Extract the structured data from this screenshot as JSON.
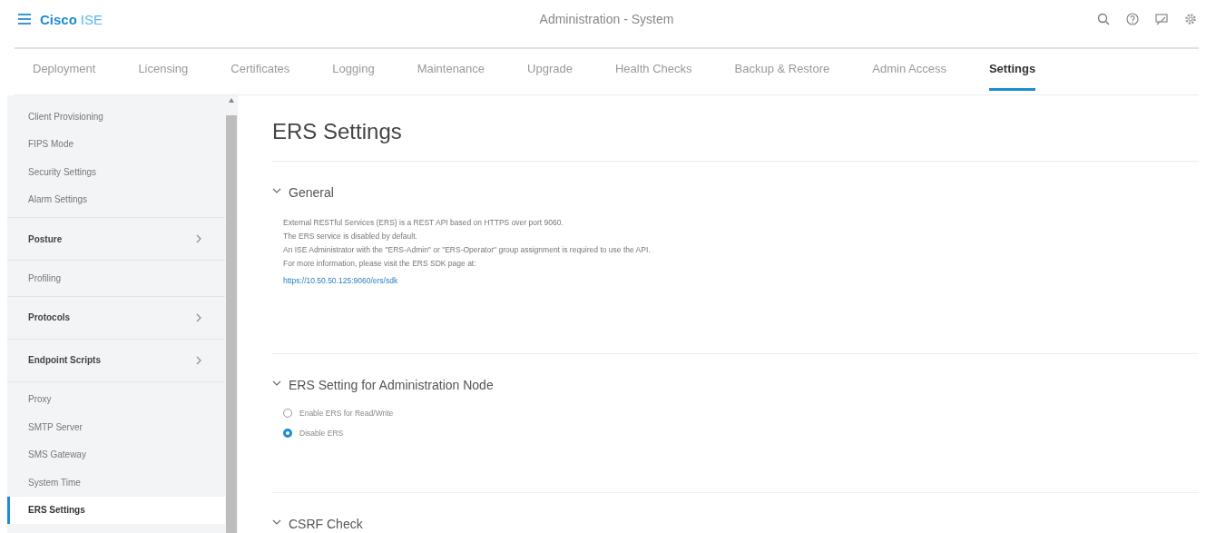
{
  "header": {
    "brand": "Cisco",
    "product": "ISE",
    "title": "Administration - System"
  },
  "tabs": [
    {
      "label": "Deployment",
      "selected": false
    },
    {
      "label": "Licensing",
      "selected": false
    },
    {
      "label": "Certificates",
      "selected": false
    },
    {
      "label": "Logging",
      "selected": false
    },
    {
      "label": "Maintenance",
      "selected": false
    },
    {
      "label": "Upgrade",
      "selected": false
    },
    {
      "label": "Health Checks",
      "selected": false
    },
    {
      "label": "Backup & Restore",
      "selected": false
    },
    {
      "label": "Admin Access",
      "selected": false
    },
    {
      "label": "Settings",
      "selected": true
    }
  ],
  "sidebar": {
    "sections": [
      [
        {
          "label": "Client Provisioning",
          "kind": "link",
          "selected": false
        },
        {
          "label": "FIPS Mode",
          "kind": "link",
          "selected": false
        },
        {
          "label": "Security Settings",
          "kind": "link",
          "selected": false
        },
        {
          "label": "Alarm Settings",
          "kind": "link",
          "selected": false
        }
      ],
      [
        {
          "label": "Posture",
          "kind": "expander",
          "selected": false
        }
      ],
      [
        {
          "label": "Profiling",
          "kind": "link",
          "selected": false
        }
      ],
      [
        {
          "label": "Protocols",
          "kind": "expander",
          "selected": false
        }
      ],
      [
        {
          "label": "Endpoint Scripts",
          "kind": "expander",
          "selected": false
        }
      ],
      [
        {
          "label": "Proxy",
          "kind": "link",
          "selected": false
        },
        {
          "label": "SMTP Server",
          "kind": "link",
          "selected": false
        },
        {
          "label": "SMS Gateway",
          "kind": "link",
          "selected": false
        },
        {
          "label": "System Time",
          "kind": "link",
          "selected": false
        },
        {
          "label": "ERS Settings",
          "kind": "link",
          "selected": true
        }
      ]
    ]
  },
  "page": {
    "title": "ERS Settings",
    "sections": [
      {
        "title": "General",
        "expanded": true,
        "kind": "text",
        "lines": [
          "External RESTful Services (ERS) is a REST API based on HTTPS over port 9060.",
          "The ERS service is disabled by default.",
          "An ISE Administrator with the \"ERS-Admin\" or \"ERS-Operator\" group assignment is required to use the API.",
          "For more information, please visit the ERS SDK page at:"
        ],
        "link": "https://10.50.50.125:9060/ers/sdk"
      },
      {
        "title": "ERS Setting for Administration Node",
        "expanded": true,
        "kind": "radio",
        "options": [
          {
            "label": "Enable ERS for Read/Write",
            "selected": false
          },
          {
            "label": "Disable ERS",
            "selected": true
          }
        ]
      },
      {
        "title": "CSRF Check",
        "expanded": true,
        "kind": "empty"
      }
    ]
  }
}
